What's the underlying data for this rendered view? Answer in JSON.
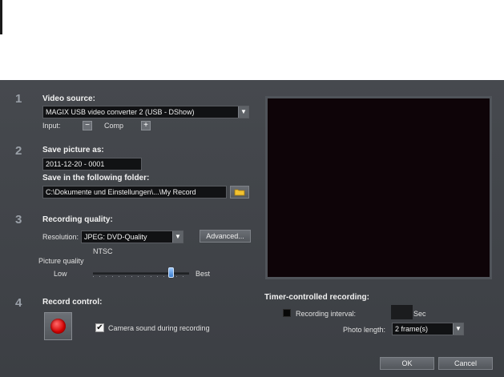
{
  "sections": [
    {
      "number": "1"
    },
    {
      "number": "2"
    },
    {
      "number": "3"
    },
    {
      "number": "4"
    }
  ],
  "video_source": {
    "heading": "Video source:",
    "selected": "MAGIX USB video converter 2 (USB - DShow)",
    "input_label": "Input:",
    "input_value": "Comp",
    "minus_glyph": "−",
    "plus_glyph": "+"
  },
  "save_picture": {
    "heading": "Save picture as:",
    "filename": "2011-12-20 - 0001",
    "folder_heading": "Save in the following folder:",
    "folder_path": "C:\\Dokumente und Einstellungen\\...\\My Record"
  },
  "recording_quality": {
    "heading": "Recording quality:",
    "resolution_label": "Resolution:",
    "resolution_value": "JPEG: DVD-Quality",
    "advanced_label": "Advanced...",
    "standard": "NTSC",
    "picture_quality_label": "Picture quality",
    "low_label": "Low",
    "best_label": "Best",
    "quality_level": 0.83
  },
  "record_control": {
    "heading": "Record control:",
    "camera_sound_label": "Camera sound during recording",
    "camera_sound_checked": true,
    "check_glyph": "✔"
  },
  "timer": {
    "heading": "Timer-controlled recording:",
    "interval_label": "Recording interval:",
    "interval_value": "",
    "interval_unit": "Sec",
    "photo_length_label": "Photo length:",
    "photo_length_value": "2 frame(s)"
  },
  "dropdown_arrow_glyph": "▼",
  "footer": {
    "ok_label": "OK",
    "cancel_label": "Cancel"
  },
  "colors": {
    "record_button": "#d40000",
    "preview_bg": "#0e0408"
  }
}
